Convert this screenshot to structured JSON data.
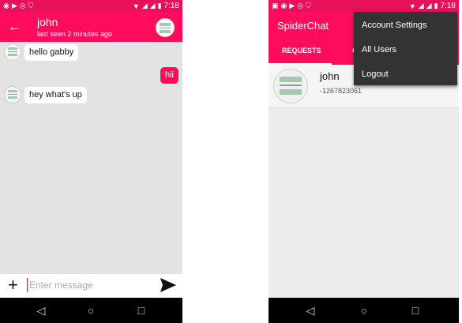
{
  "left": {
    "status": {
      "time": "7:18",
      "icons": [
        "whatsapp-icon",
        "youtube-icon",
        "record-icon",
        "shield-icon"
      ]
    },
    "header": {
      "name": "john",
      "last_seen": "last seen 2 minutes ago"
    },
    "messages": [
      {
        "text": "hello gabby",
        "sender": "other"
      },
      {
        "text": "hii",
        "sender": "me"
      },
      {
        "text": "hey what's up",
        "sender": "other"
      }
    ],
    "composer": {
      "placeholder": "Enter message"
    }
  },
  "right": {
    "status": {
      "time": "7:18",
      "icons": [
        "image-icon",
        "whatsapp-icon",
        "youtube-icon",
        "record-icon",
        "shield-icon"
      ]
    },
    "app_title": "SpiderChat",
    "tabs": [
      {
        "label": "REQUESTS"
      },
      {
        "label": "C"
      }
    ],
    "users": [
      {
        "name": "john",
        "phone": "-1267823061"
      }
    ],
    "menu": [
      {
        "label": "Account Settings"
      },
      {
        "label": "All Users"
      },
      {
        "label": "Logout"
      }
    ]
  },
  "colors": {
    "accent": "#ff0d5c",
    "status_bar": "#e8105a",
    "menu_bg": "#333333"
  }
}
